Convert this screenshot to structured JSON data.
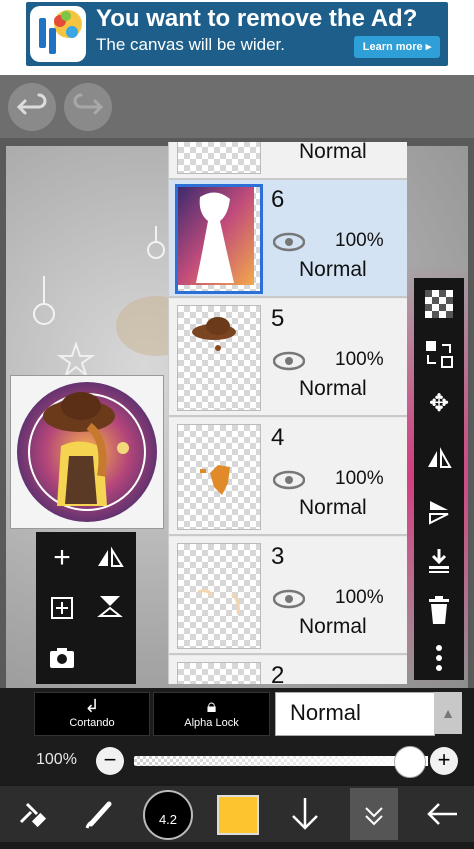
{
  "ad": {
    "title": "You want to remove the Ad?",
    "subtitle": "The canvas will be wider.",
    "cta": "Learn more ▸"
  },
  "layers": [
    {
      "number": "",
      "opacity": "",
      "blend": "Normal"
    },
    {
      "number": "6",
      "opacity": "100%",
      "blend": "Normal",
      "selected": true
    },
    {
      "number": "5",
      "opacity": "100%",
      "blend": "Normal"
    },
    {
      "number": "4",
      "opacity": "100%",
      "blend": "Normal"
    },
    {
      "number": "3",
      "opacity": "100%",
      "blend": "Normal"
    },
    {
      "number": "2",
      "opacity": "",
      "blend": ""
    }
  ],
  "controls": {
    "clipping_label": "Cortando",
    "alpha_lock_label": "Alpha Lock",
    "blend_mode": "Normal",
    "opacity_label": "100%",
    "opacity_value": 1.0
  },
  "bottom_nav": {
    "brush_size": "4.2",
    "color": "#fcc530"
  },
  "icons": {
    "ad_logo": "ibispaint-logo-icon",
    "undo": "undo-icon",
    "redo": "redo-icon",
    "add_layer": "plus-icon",
    "flip_layer": "flip-icon",
    "copy_layer": "copy-layer-icon",
    "merge": "merge-icon",
    "camera": "camera-icon",
    "eye": "eye-icon",
    "checker": "transparent-bg-icon",
    "swap": "swap-icon",
    "move": "move-icon",
    "flip_h": "flip-horizontal-icon",
    "flip_v": "flip-vertical-icon",
    "merge_down": "merge-down-icon",
    "trash": "trash-icon",
    "more": "more-vert-icon",
    "tools": "tools-icon",
    "brush": "brush-icon",
    "down_arrow": "arrow-down-icon",
    "layer": "layer-icon",
    "back": "back-arrow-icon"
  }
}
